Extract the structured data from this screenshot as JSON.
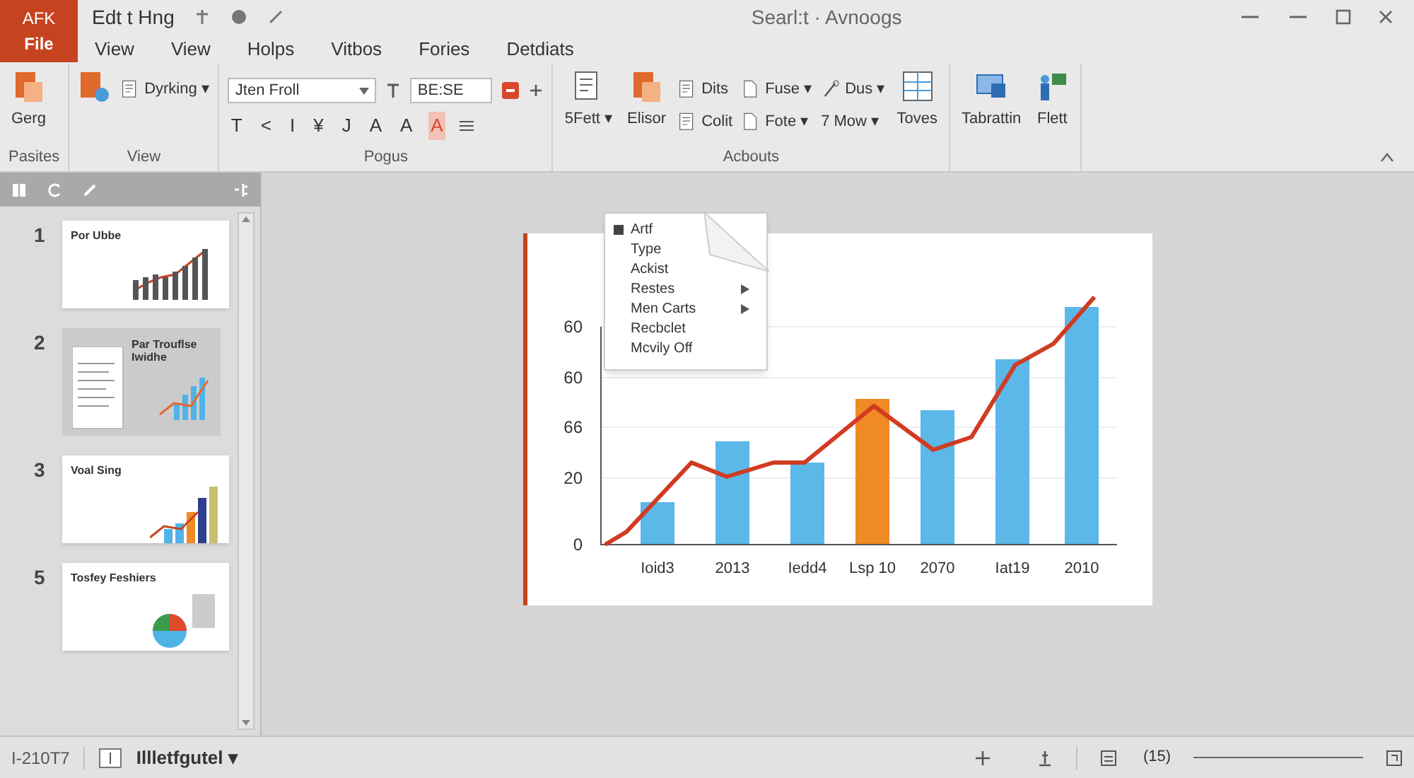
{
  "file_tab": {
    "top": "AFK",
    "label": "File"
  },
  "title_bar": {
    "doc_title": "Edt t Hng",
    "search": "Searl:t · Avnoogs"
  },
  "tabs": [
    {
      "label": "View",
      "selected": false
    },
    {
      "label": "View",
      "selected": false
    },
    {
      "label": "Holps",
      "selected": false
    },
    {
      "label": "Vitbos",
      "selected": false
    },
    {
      "label": "Fories",
      "selected": false
    },
    {
      "label": "Detdiats",
      "selected": false
    }
  ],
  "ribbon": [
    {
      "name": "Pasites",
      "items": [
        {
          "kind": "large",
          "label": "Gerg"
        }
      ]
    },
    {
      "name": "View",
      "items": [
        {
          "kind": "icon"
        },
        {
          "kind": "column",
          "items": [
            {
              "label": "Dyrking ▾"
            }
          ]
        }
      ]
    },
    {
      "name": "Pogus",
      "items": [
        {
          "kind": "font",
          "font": "Jten Froll",
          "size": "BE:SE",
          "glyphs": [
            {
              "glyph": "T",
              "selected": false
            },
            {
              "glyph": "<",
              "selected": false
            },
            {
              "glyph": "I",
              "selected": false
            },
            {
              "glyph": "¥",
              "selected": false
            },
            {
              "glyph": "J",
              "selected": false
            },
            {
              "glyph": "A",
              "selected": false
            },
            {
              "glyph": "A",
              "selected": false
            },
            {
              "glyph": "A",
              "selected": true
            }
          ]
        }
      ]
    },
    {
      "name": "Acbouts",
      "items": [
        {
          "kind": "large",
          "label": "5Fett ▾"
        },
        {
          "kind": "large",
          "label": "Elisor"
        },
        {
          "kind": "column",
          "items": [
            {
              "label": "Dits"
            },
            {
              "label": "Colit"
            }
          ]
        },
        {
          "kind": "column",
          "items": [
            {
              "label": "Fuse ▾"
            },
            {
              "label": "Fote ▾"
            }
          ]
        },
        {
          "kind": "column",
          "items": [
            {
              "label": "Dus ▾"
            },
            {
              "label": "7 Mow ▾"
            }
          ]
        },
        {
          "kind": "large",
          "label": "Toves"
        }
      ]
    },
    {
      "items": [
        {
          "kind": "large",
          "label": "Tabrattin"
        },
        {
          "kind": "large",
          "label": "Flett"
        }
      ]
    }
  ],
  "slides": [
    {
      "number": "1",
      "title": "Por Ubbe",
      "selected": false,
      "kind": "bars"
    },
    {
      "number": "2",
      "title": "Par Trouflse Iwidhe",
      "selected": true,
      "kind": "doc"
    },
    {
      "number": "3",
      "title": "Voal Sing",
      "selected": false,
      "kind": "columns"
    },
    {
      "number": "5",
      "title": "Tosfey Feshiers",
      "selected": false,
      "kind": "pie"
    }
  ],
  "chart": {
    "y_labels": [
      "60",
      "60",
      "66",
      "20",
      "0"
    ],
    "x_labels": [
      "Ioid3",
      "2013",
      "Iedd4",
      "Lsp 10",
      "2070",
      "Iat19",
      "2010"
    ],
    "bars": [
      {
        "highlighted": false
      },
      {
        "highlighted": false
      },
      {
        "highlighted": false
      },
      {
        "highlighted": true
      },
      {
        "highlighted": false
      },
      {
        "highlighted": false
      },
      {
        "highlighted": false
      }
    ]
  },
  "context_menu": [
    {
      "label": "Artf",
      "submenu": false
    },
    {
      "label": "Type",
      "submenu": false
    },
    {
      "label": "Ackist",
      "submenu": false
    },
    {
      "label": "Restes",
      "submenu": true
    },
    {
      "label": "Men Carts",
      "submenu": true
    },
    {
      "label": "Recbclet",
      "submenu": false
    },
    {
      "label": "Mcvily Off",
      "submenu": false
    }
  ],
  "status_bar": {
    "slide_info": "I-210T7",
    "language": "Illletfgutel ▾",
    "zoom": "(15)"
  }
}
